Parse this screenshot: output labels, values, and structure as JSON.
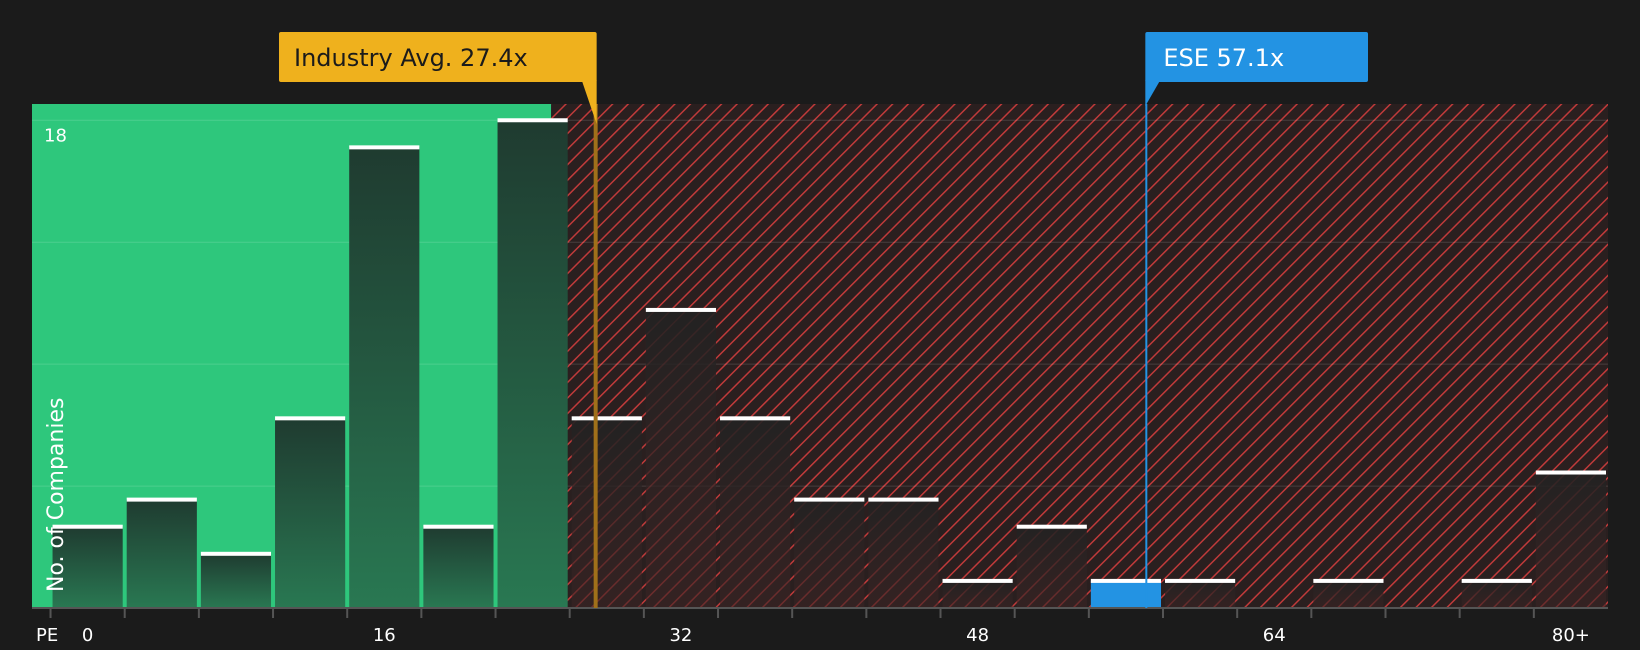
{
  "chart_data": {
    "type": "bar",
    "xlabel": "PE",
    "ylabel": "No. of Companies",
    "y_tick_labels": [
      "18"
    ],
    "x_tick_labels": [
      "0",
      "16",
      "32",
      "48",
      "64",
      "80+"
    ],
    "x_tick_values": [
      0,
      16,
      32,
      48,
      64,
      80
    ],
    "xlim": [
      -3,
      82
    ],
    "ylim": [
      0,
      18.6
    ],
    "bin_width": 4,
    "x": [
      0,
      4,
      8,
      12,
      16,
      20,
      24,
      28,
      32,
      36,
      40,
      44,
      48,
      52,
      56,
      60,
      64,
      68,
      72,
      76,
      80
    ],
    "values": [
      3,
      4,
      2,
      7,
      17,
      3,
      18,
      7,
      11,
      7,
      4,
      4,
      1,
      3,
      1,
      1,
      0,
      1,
      0,
      1,
      5
    ],
    "highlight_bin_x": 56,
    "industry_avg": {
      "label": "Industry Avg. 27.4x",
      "value": 27.4
    },
    "company": {
      "label": "ESE 57.1x",
      "value": 57.1
    },
    "grid": true,
    "colors": {
      "background": "#1b1b1b",
      "good_zone": "#2ec77c",
      "bad_zone_hatch": "#c03a3a",
      "industry_avg": "#efb11d",
      "company": "#2393e3",
      "bar_cap": "#ffffff"
    }
  }
}
